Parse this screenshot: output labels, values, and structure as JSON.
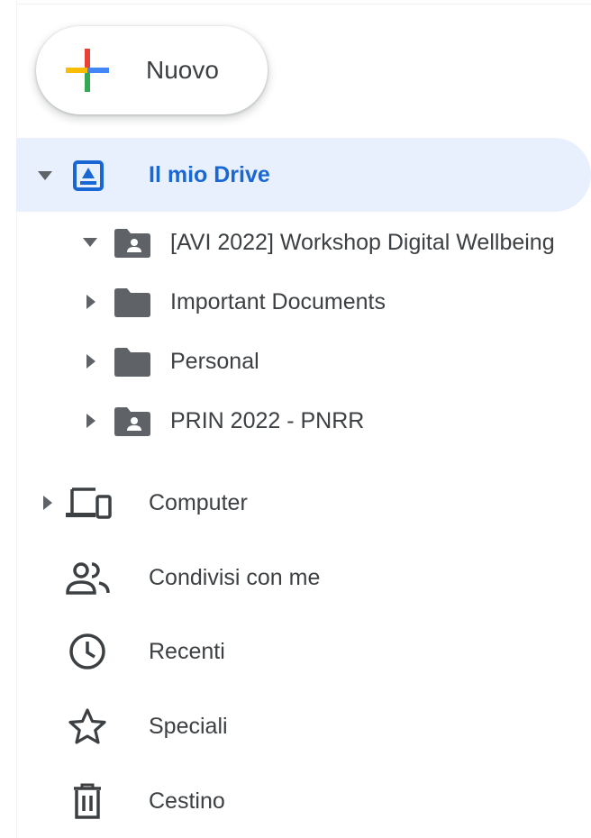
{
  "new_button": {
    "label": "Nuovo"
  },
  "nav": {
    "my_drive": {
      "label": "Il mio Drive",
      "expanded": true,
      "selected": true,
      "accent": "#1967d2",
      "highlight": "#e8f0fe"
    },
    "folders": [
      {
        "label": "[AVI 2022] Workshop Digital Wellbeing",
        "shared": true,
        "expanded": true
      },
      {
        "label": "Important Documents",
        "shared": false,
        "expanded": false
      },
      {
        "label": "Personal",
        "shared": false,
        "expanded": false
      },
      {
        "label": "PRIN 2022 - PNRR",
        "shared": true,
        "expanded": false
      }
    ],
    "computer": {
      "label": "Computer",
      "icon": "computer-icon"
    },
    "shared_with_me": {
      "label": "Condivisi con me",
      "icon": "people-icon"
    },
    "recent": {
      "label": "Recenti",
      "icon": "clock-icon"
    },
    "starred": {
      "label": "Speciali",
      "icon": "star-icon"
    },
    "trash": {
      "label": "Cestino",
      "icon": "trash-icon"
    }
  }
}
